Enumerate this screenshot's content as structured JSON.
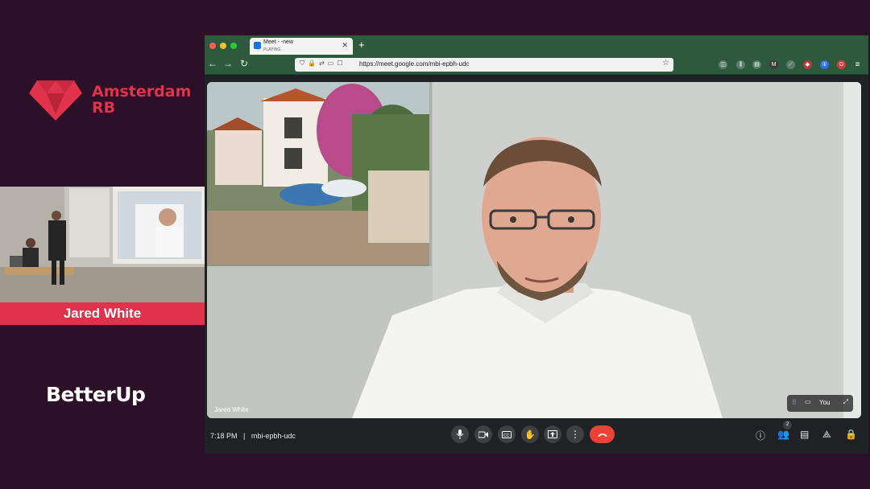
{
  "event": {
    "brand_line1": "Amsterdam",
    "brand_line2": "RB",
    "speaker_name": "Jared White",
    "sponsor": "BetterUp",
    "accent_color": "#e0324b",
    "background_color": "#2b1028"
  },
  "browser": {
    "tab_title": "Meet - -new",
    "tab_subtitle": "PLAYING",
    "url": "https://meet.google.com/mbi-epbh-udc",
    "toolbar_color": "#2d5a3d"
  },
  "meet": {
    "participant_name": "Jared White",
    "self_label": "You",
    "time": "7:18 PM",
    "separator": "|",
    "meeting_code": "mbi-epbh-udc",
    "participants_count": "2"
  },
  "icons": {
    "mic": "mic-icon",
    "camera": "camera-icon",
    "captions": "captions-icon",
    "hand": "raise-hand-icon",
    "present": "present-icon",
    "more": "more-vert-icon",
    "hangup": "hangup-icon",
    "info": "info-icon",
    "people": "people-icon",
    "chat": "chat-icon",
    "activities": "activities-icon",
    "host": "host-controls-icon"
  }
}
